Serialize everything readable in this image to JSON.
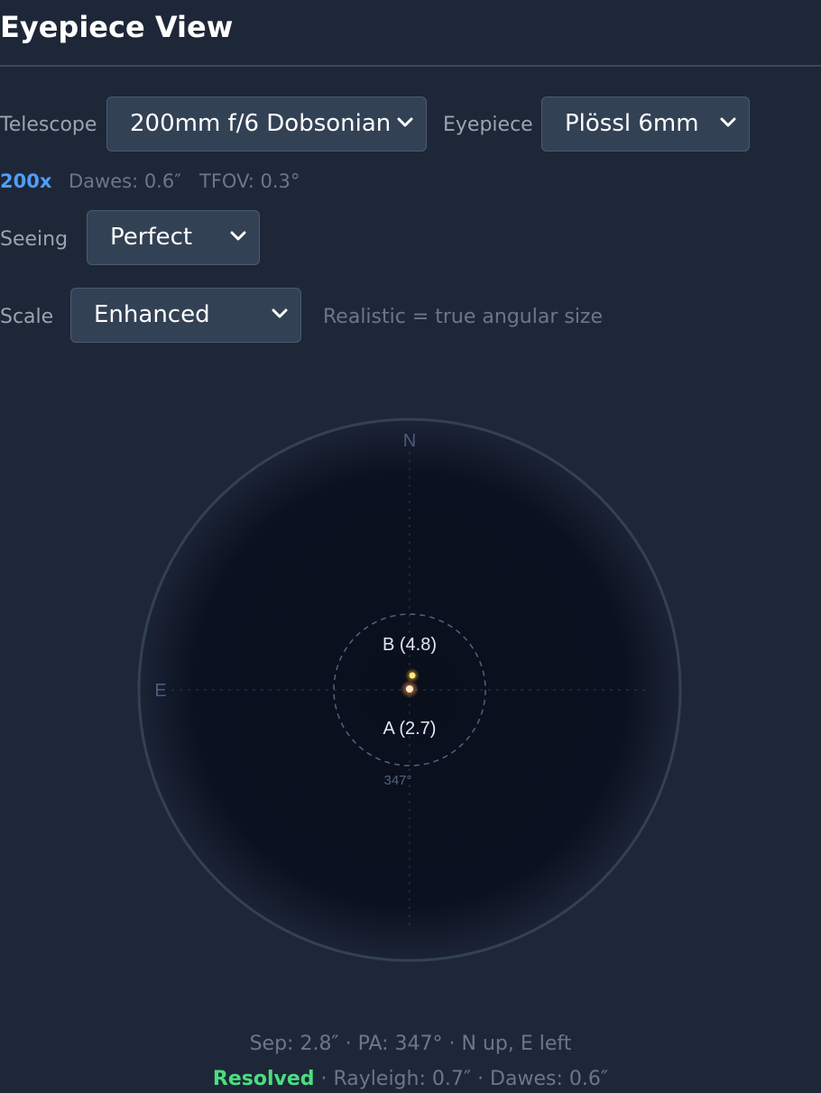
{
  "header": {
    "title": "Eyepiece View"
  },
  "controls": {
    "telescope_label": "Telescope",
    "telescope_value": "200mm f/6 Dobsonian",
    "eyepiece_label": "Eyepiece",
    "eyepiece_value": "Plössl 6mm",
    "seeing_label": "Seeing",
    "seeing_value": "Perfect",
    "scale_label": "Scale",
    "scale_value": "Enhanced",
    "scale_hint": "Realistic = true angular size"
  },
  "stats": {
    "magnification": "200x",
    "dawes": "Dawes: 0.6″",
    "tfov": "TFOV: 0.3°"
  },
  "view": {
    "north_label": "N",
    "east_label": "E",
    "star_a_label": "A (2.7)",
    "star_b_label": "B (4.8)",
    "pa_label": "347°",
    "colors": {
      "field": "#0a0f1c",
      "rim": "#334155",
      "star_a": "#f97316",
      "star_b": "#eab308"
    }
  },
  "footer": {
    "line1": "Sep: 2.8″ · PA: 347° · N up, E left",
    "status": "Resolved",
    "line2_rest": " · Rayleigh: 0.7″ · Dawes: 0.6″"
  }
}
